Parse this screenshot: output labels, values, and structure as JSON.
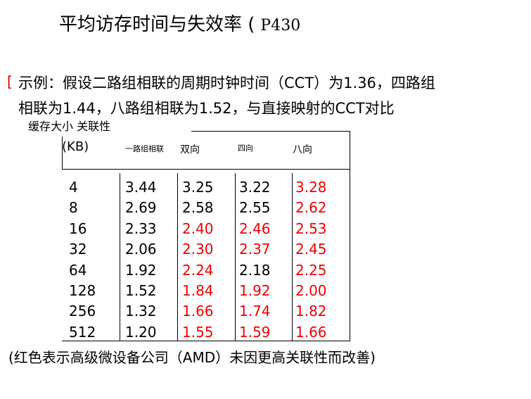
{
  "title": "平均访存时间与失效率 (",
  "title_suffix": "P430",
  "bullet": "[",
  "intro_line1": "示例：假设二路组相联的周期时钟时间（CCT）为1.36，四路组",
  "intro_line2": "相联为1.44，八路组相联为1.52，与直接映射的CCT对比",
  "table_caption": "缓存大小 关联性",
  "table": {
    "size_header": "(KB)",
    "headers": [
      "一路组相联",
      "双向",
      "四向",
      "八向"
    ],
    "rows": [
      {
        "size": "4",
        "values": [
          "3.44",
          "3.25",
          "3.22",
          "3.28"
        ],
        "red": [
          false,
          false,
          false,
          true
        ]
      },
      {
        "size": "8",
        "values": [
          "2.69",
          "2.58",
          "2.55",
          "2.62"
        ],
        "red": [
          false,
          false,
          false,
          true
        ]
      },
      {
        "size": "16",
        "values": [
          "2.33",
          "2.40",
          "2.46",
          "2.53"
        ],
        "red": [
          false,
          true,
          true,
          true
        ]
      },
      {
        "size": "32",
        "values": [
          "2.06",
          "2.30",
          "2.37",
          "2.45"
        ],
        "red": [
          false,
          true,
          true,
          true
        ]
      },
      {
        "size": "64",
        "values": [
          "1.92",
          "2.24",
          "2.18",
          "2.25"
        ],
        "red": [
          false,
          true,
          false,
          true
        ]
      },
      {
        "size": "128",
        "values": [
          "1.52",
          "1.84",
          "1.92",
          "2.00"
        ],
        "red": [
          false,
          true,
          true,
          true
        ]
      },
      {
        "size": "256",
        "values": [
          "1.32",
          "1.66",
          "1.74",
          "1.82"
        ],
        "red": [
          false,
          true,
          true,
          true
        ]
      },
      {
        "size": "512",
        "values": [
          "1.20",
          "1.55",
          "1.59",
          "1.66"
        ],
        "red": [
          false,
          true,
          true,
          true
        ]
      }
    ]
  },
  "footer_note": "(红色表示高级微设备公司（AMD）未因更高关联性而改善)",
  "colors": {
    "highlight": "#ee0000",
    "text": "#000000",
    "background": "#ffffff"
  }
}
